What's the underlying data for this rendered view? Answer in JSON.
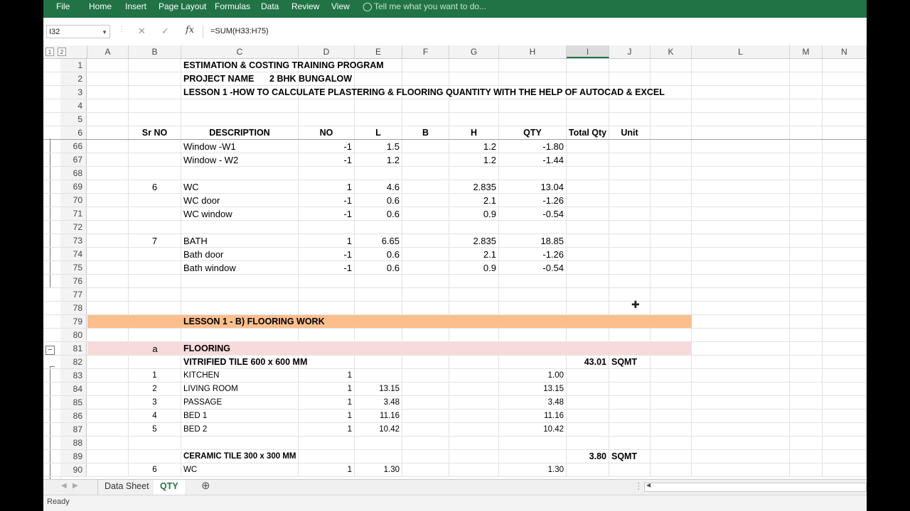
{
  "ribbon": {
    "tabs": [
      "File",
      "Home",
      "Insert",
      "Page Layout",
      "Formulas",
      "Data",
      "Review",
      "View"
    ],
    "tell_me": "Tell me what you want to do..."
  },
  "formula_bar": {
    "name_box": "I32",
    "formula": "=SUM(H33:H75)"
  },
  "columns": [
    "A",
    "B",
    "C",
    "D",
    "E",
    "F",
    "G",
    "H",
    "I",
    "J",
    "K",
    "L",
    "M",
    "N"
  ],
  "outline_levels": [
    "1",
    "2"
  ],
  "rows": [
    {
      "n": "1",
      "C": "ESTIMATION & COSTING TRAINING PROGRAM"
    },
    {
      "n": "2",
      "C": "PROJECT NAME",
      "D": "2 BHK BUNGALOW"
    },
    {
      "n": "3",
      "C": "LESSON 1 -HOW TO CALCULATE PLASTERING & FLOORING QUANTITY WITH THE HELP OF AUTOCAD & EXCEL"
    },
    {
      "n": "4"
    },
    {
      "n": "5"
    },
    {
      "n": "6",
      "B": "Sr NO",
      "C": "DESCRIPTION",
      "D": "NO",
      "E": "L",
      "F": "B",
      "G": "H",
      "H": "QTY",
      "I": "Total Qty",
      "J": "Unit"
    },
    {
      "n": "66",
      "C": "Window -W1",
      "D": "-1",
      "E": "1.5",
      "G": "1.2",
      "H": "-1.80"
    },
    {
      "n": "67",
      "C": "Window - W2",
      "D": "-1",
      "E": "1.2",
      "G": "1.2",
      "H": "-1.44"
    },
    {
      "n": "68"
    },
    {
      "n": "69",
      "B": "6",
      "C": "WC",
      "D": "1",
      "E": "4.6",
      "G": "2.835",
      "H": "13.04"
    },
    {
      "n": "70",
      "C": "WC door",
      "D": "-1",
      "E": "0.6",
      "G": "2.1",
      "H": "-1.26"
    },
    {
      "n": "71",
      "C": "WC window",
      "D": "-1",
      "E": "0.6",
      "G": "0.9",
      "H": "-0.54"
    },
    {
      "n": "72"
    },
    {
      "n": "73",
      "B": "7",
      "C": "BATH",
      "D": "1",
      "E": "6.65",
      "G": "2.835",
      "H": "18.85"
    },
    {
      "n": "74",
      "C": "Bath door",
      "D": "-1",
      "E": "0.6",
      "G": "2.1",
      "H": "-1.26"
    },
    {
      "n": "75",
      "C": "Bath window",
      "D": "-1",
      "E": "0.6",
      "G": "0.9",
      "H": "-0.54"
    },
    {
      "n": "76"
    },
    {
      "n": "77"
    },
    {
      "n": "78"
    },
    {
      "n": "79",
      "C": "LESSON 1 - B) FLOORING WORK"
    },
    {
      "n": "80"
    },
    {
      "n": "81",
      "B": "a",
      "C": "FLOORING"
    },
    {
      "n": "82",
      "C": "VITRIFIED TILE 600 x 600 MM",
      "I": "43.01",
      "J": "SQMT"
    },
    {
      "n": "83",
      "B": "1",
      "C": "KITCHEN",
      "D": "1",
      "H": "1.00"
    },
    {
      "n": "84",
      "B": "2",
      "C": "LIVING ROOM",
      "D": "1",
      "E": "13.15",
      "H": "13.15"
    },
    {
      "n": "85",
      "B": "3",
      "C": "PASSAGE",
      "D": "1",
      "E": "3.48",
      "H": "3.48"
    },
    {
      "n": "86",
      "B": "4",
      "C": "BED 1",
      "D": "1",
      "E": "11.16",
      "H": "11.16"
    },
    {
      "n": "87",
      "B": "5",
      "C": "BED 2",
      "D": "1",
      "E": "10.42",
      "H": "10.42"
    },
    {
      "n": "88"
    },
    {
      "n": "89",
      "C": "CERAMIC TILE 300 x 300 MM",
      "I": "3.80",
      "J": "SQMT"
    },
    {
      "n": "90",
      "B": "6",
      "C": "WC",
      "D": "1",
      "E": "1.30",
      "H": "1.30"
    }
  ],
  "sheets": [
    "Data Sheet",
    "QTY"
  ],
  "active_sheet": "QTY",
  "status": "Ready",
  "colors": {
    "accent": "#217346",
    "peach_fill": "#fbbf8e",
    "pink_fill": "#f8dadb"
  }
}
